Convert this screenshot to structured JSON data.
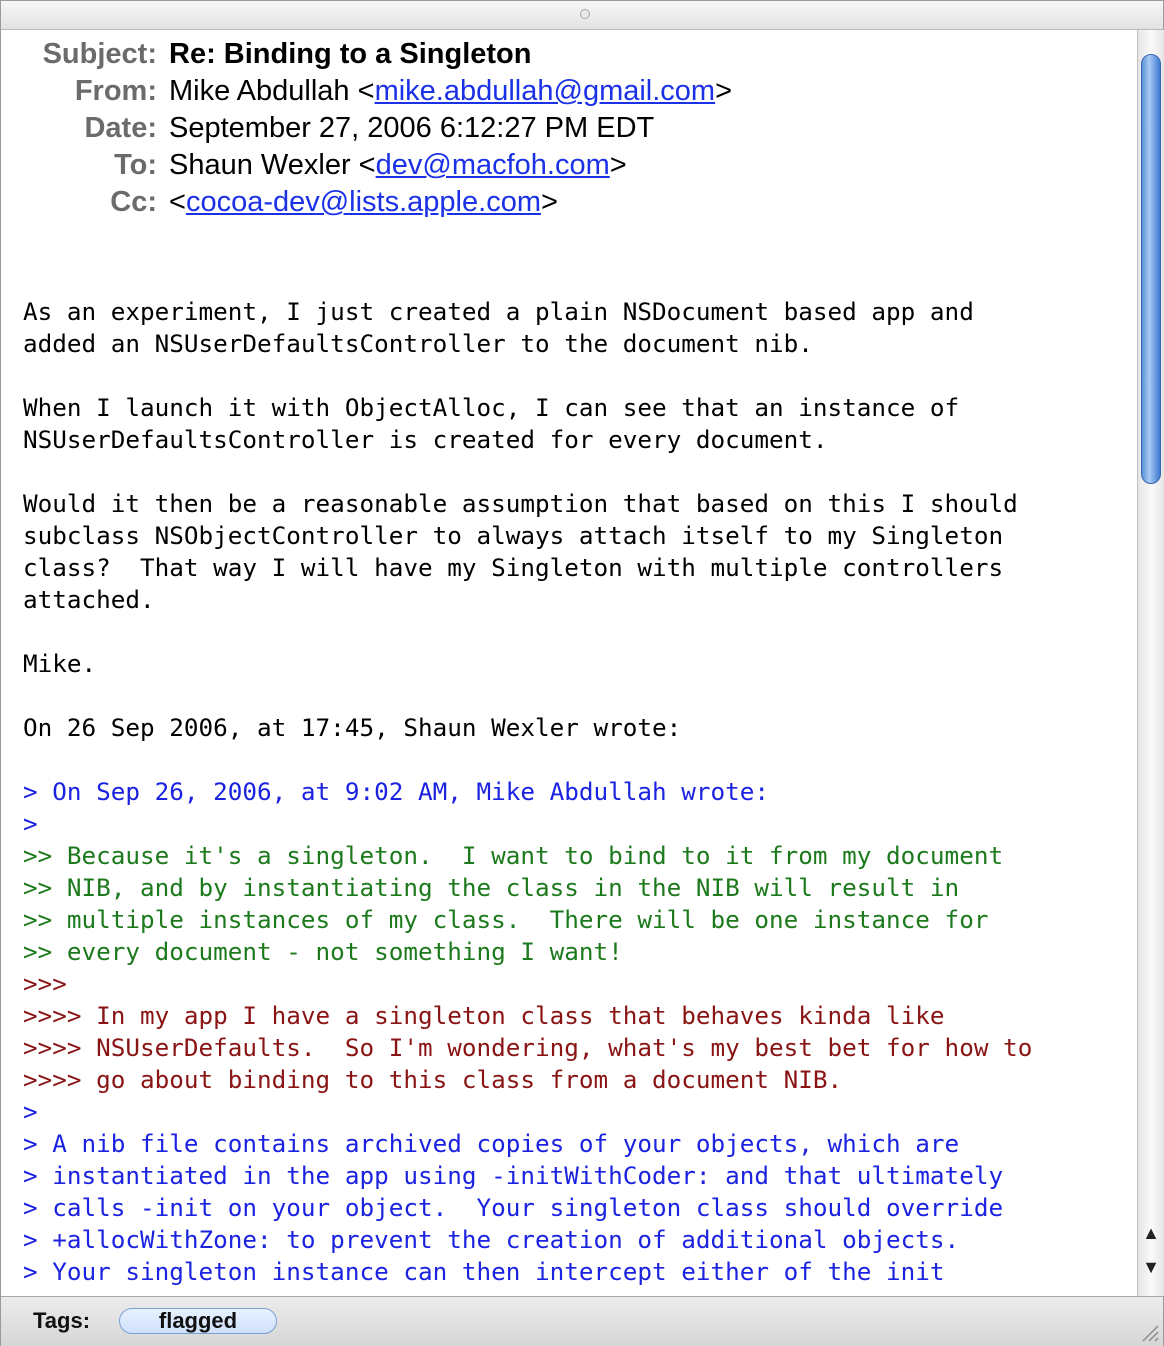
{
  "headers": {
    "subject_label": "Subject:",
    "subject": "Re: Binding to a Singleton",
    "from_label": "From:",
    "from_name": "Mike Abdullah <",
    "from_email": "mike.abdullah@gmail.com",
    "from_close": ">",
    "date_label": "Date:",
    "date": "September 27, 2006 6:12:27 PM EDT",
    "to_label": "To:",
    "to_name": "Shaun Wexler <",
    "to_email": "dev@macfoh.com",
    "to_close": ">",
    "cc_label": "Cc:",
    "cc_open": "<",
    "cc_email": "cocoa-dev@lists.apple.com",
    "cc_close": ">"
  },
  "body_lines": [
    {
      "text": "As an experiment, I just created a plain NSDocument based app and",
      "quote": 0
    },
    {
      "text": "added an NSUserDefaultsController to the document nib.",
      "quote": 0
    },
    {
      "text": "",
      "quote": 0
    },
    {
      "text": "When I launch it with ObjectAlloc, I can see that an instance of",
      "quote": 0
    },
    {
      "text": "NSUserDefaultsController is created for every document.",
      "quote": 0
    },
    {
      "text": "",
      "quote": 0
    },
    {
      "text": "Would it then be a reasonable assumption that based on this I should",
      "quote": 0
    },
    {
      "text": "subclass NSObjectController to always attach itself to my Singleton",
      "quote": 0
    },
    {
      "text": "class?  That way I will have my Singleton with multiple controllers",
      "quote": 0
    },
    {
      "text": "attached.",
      "quote": 0
    },
    {
      "text": "",
      "quote": 0
    },
    {
      "text": "Mike.",
      "quote": 0
    },
    {
      "text": "",
      "quote": 0
    },
    {
      "text": "On 26 Sep 2006, at 17:45, Shaun Wexler wrote:",
      "quote": 0
    },
    {
      "text": "",
      "quote": 0
    },
    {
      "text": "> On Sep 26, 2006, at 9:02 AM, Mike Abdullah wrote:",
      "quote": 1
    },
    {
      "text": ">",
      "quote": 1
    },
    {
      "text": ">> Because it's a singleton.  I want to bind to it from my document",
      "quote": 2
    },
    {
      "text": ">> NIB, and by instantiating the class in the NIB will result in",
      "quote": 2
    },
    {
      "text": ">> multiple instances of my class.  There will be one instance for",
      "quote": 2
    },
    {
      "text": ">> every document - not something I want!",
      "quote": 2
    },
    {
      "text": ">>>",
      "quote": 3
    },
    {
      "text": ">>>> In my app I have a singleton class that behaves kinda like",
      "quote": 3
    },
    {
      "text": ">>>> NSUserDefaults.  So I'm wondering, what's my best bet for how to",
      "quote": 3
    },
    {
      "text": ">>>> go about binding to this class from a document NIB.",
      "quote": 3
    },
    {
      "text": ">",
      "quote": 1
    },
    {
      "text": "> A nib file contains archived copies of your objects, which are",
      "quote": 1
    },
    {
      "text": "> instantiated in the app using -initWithCoder: and that ultimately",
      "quote": 1
    },
    {
      "text": "> calls -init on your object.  Your singleton class should override",
      "quote": 1
    },
    {
      "text": "> +allocWithZone: to prevent the creation of additional objects.",
      "quote": 1
    },
    {
      "text": "> Your singleton instance can then intercept either of the init",
      "quote": 1
    }
  ],
  "quote_colors": [
    "#000000",
    "#1b22e0",
    "#1c7a1c",
    "#8a1414"
  ],
  "tags": {
    "label": "Tags:",
    "items": [
      "flagged"
    ]
  },
  "scroll": {
    "position_fraction": 0.0,
    "visible_fraction": 0.35
  }
}
